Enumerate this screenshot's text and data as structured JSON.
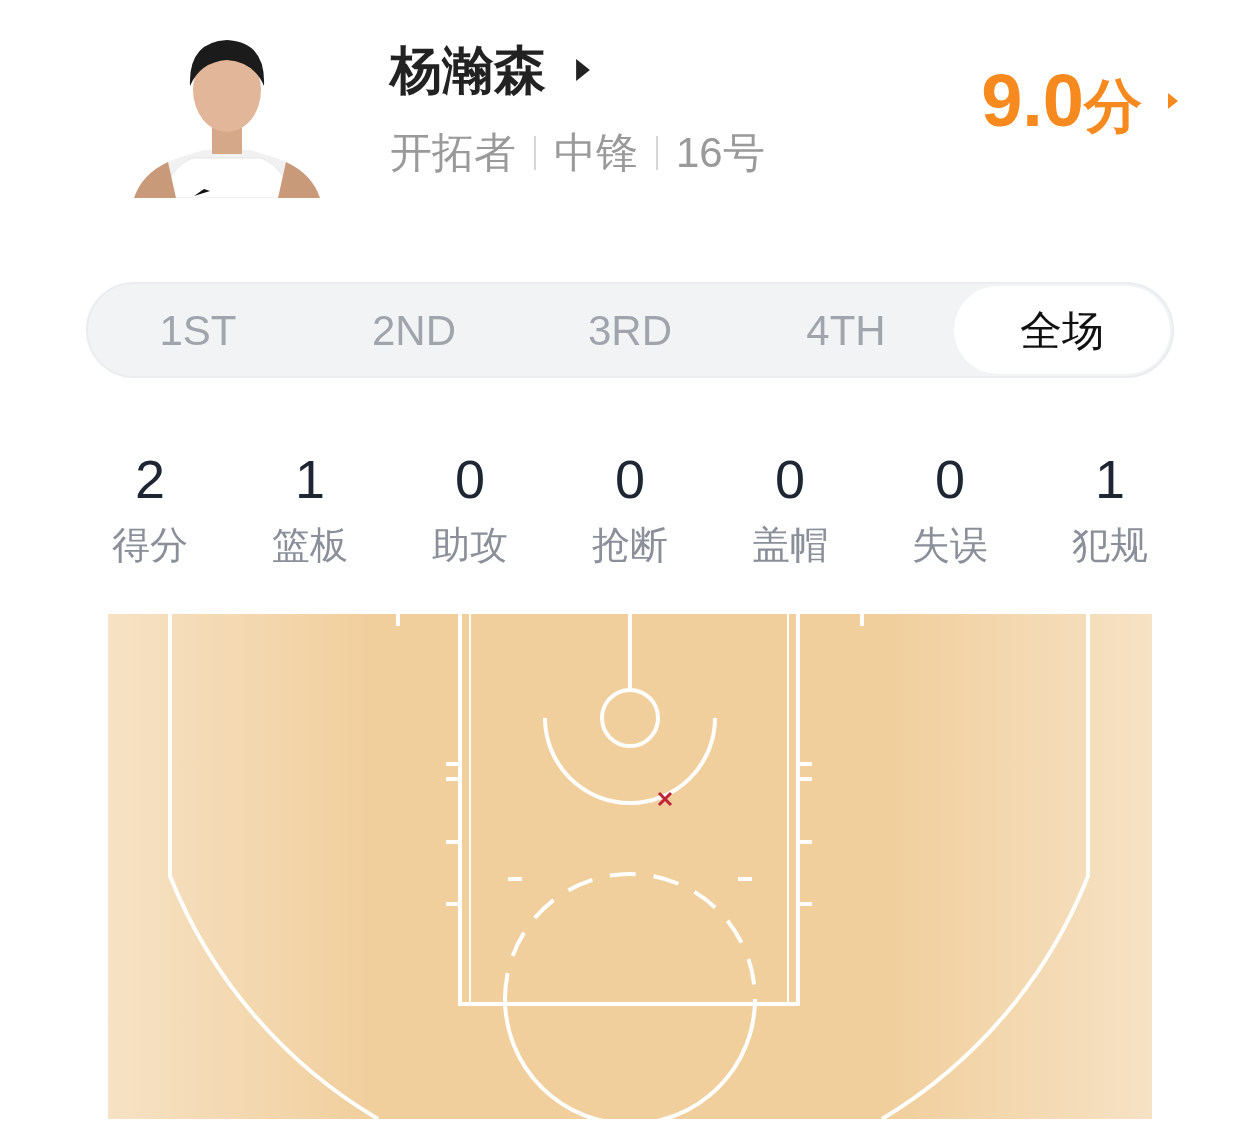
{
  "player": {
    "name": "杨瀚森",
    "team": "开拓者",
    "position": "中锋",
    "number": "16号"
  },
  "rating": {
    "value": "9.0",
    "unit": "分"
  },
  "tabs": [
    {
      "label": "1ST",
      "selected": false
    },
    {
      "label": "2ND",
      "selected": false
    },
    {
      "label": "3RD",
      "selected": false
    },
    {
      "label": "4TH",
      "selected": false
    },
    {
      "label": "全场",
      "selected": true
    }
  ],
  "stats": [
    {
      "value": "2",
      "label": "得分"
    },
    {
      "value": "1",
      "label": "篮板"
    },
    {
      "value": "0",
      "label": "助攻"
    },
    {
      "value": "0",
      "label": "抢断"
    },
    {
      "value": "0",
      "label": "盖帽"
    },
    {
      "value": "0",
      "label": "失误"
    },
    {
      "value": "1",
      "label": "犯规"
    }
  ]
}
